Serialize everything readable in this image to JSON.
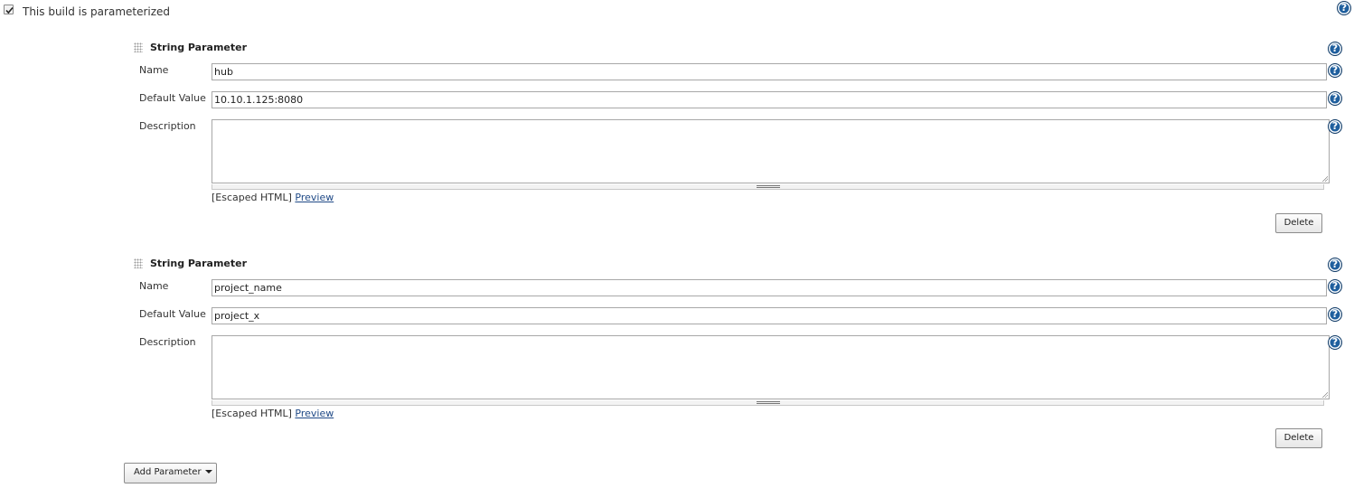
{
  "parameterized": {
    "checked": true,
    "label": "This build is parameterized"
  },
  "parameters": [
    {
      "type_label": "String Parameter",
      "name_label": "Name",
      "name_value": "hub",
      "default_label": "Default Value",
      "default_value": "10.10.1.125:8080",
      "description_label": "Description",
      "description_value": "",
      "escaped_label": "[Escaped HTML]",
      "preview_label": "Preview",
      "delete_label": "Delete"
    },
    {
      "type_label": "String Parameter",
      "name_label": "Name",
      "name_value": "project_name",
      "default_label": "Default Value",
      "default_value": "project_x",
      "description_label": "Description",
      "description_value": "",
      "escaped_label": "[Escaped HTML]",
      "preview_label": "Preview",
      "delete_label": "Delete"
    }
  ],
  "add_parameter_label": "Add Parameter",
  "help_glyph": "?",
  "icons": {
    "help": "help-icon",
    "drag": "drag-handle-icon",
    "checkbox": "checkmark-icon",
    "dropdown": "caret-down-icon"
  },
  "colors": {
    "help_icon": "#1f5f9e",
    "link": "#204a87"
  }
}
